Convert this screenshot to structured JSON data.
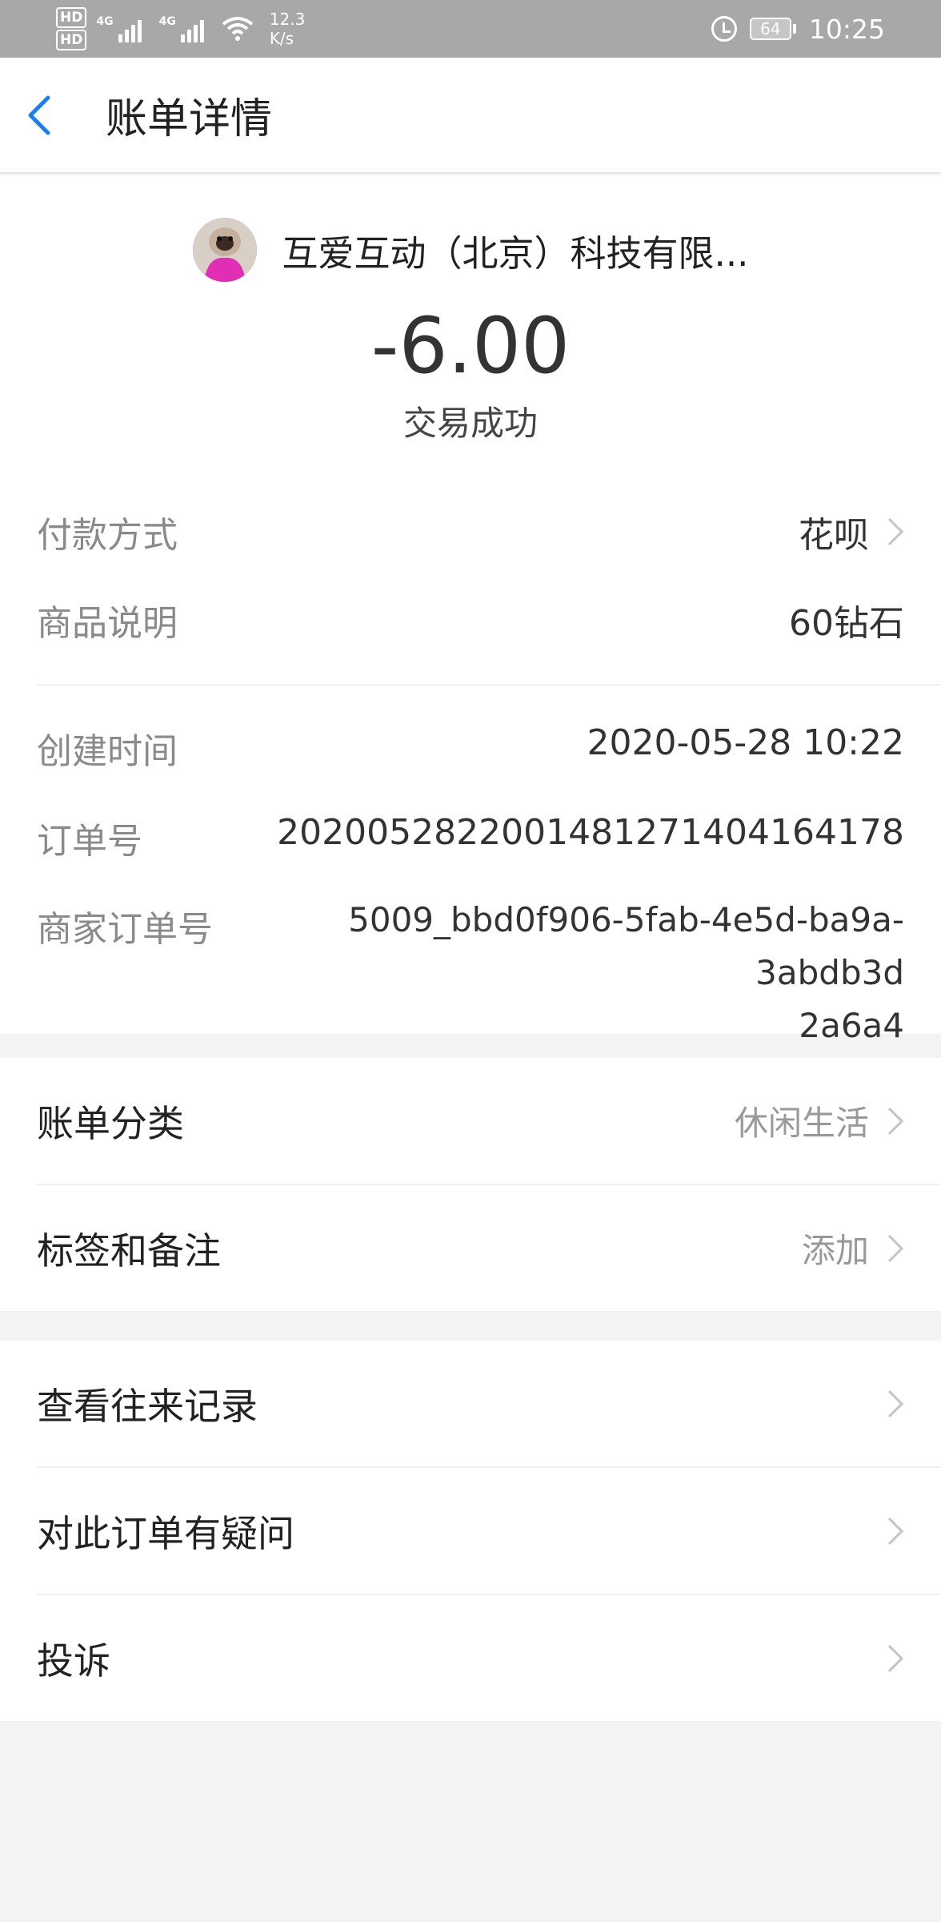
{
  "status_bar": {
    "hd1": "HD",
    "hd2": "HD",
    "net1": "4G",
    "net2": "4G",
    "speed_value": "12.3",
    "speed_unit": "K/s",
    "battery": "64",
    "time": "10:25"
  },
  "header": {
    "title": "账单详情"
  },
  "transaction": {
    "merchant_name": "互爱互动（北京）科技有限...",
    "amount": "-6.00",
    "status": "交易成功"
  },
  "details": {
    "payment_method_label": "付款方式",
    "payment_method_value": "花呗",
    "product_label": "商品说明",
    "product_value": "60钻石",
    "created_label": "创建时间",
    "created_value": "2020-05-28 10:22",
    "order_no_label": "订单号",
    "order_no_value": "2020052822001481271404164178",
    "merchant_order_label": "商家订单号",
    "merchant_order_line1": "5009_bbd0f906-5fab-4e5d-ba9a-3abdb3d",
    "merchant_order_line2": "2a6a4"
  },
  "category": {
    "category_label": "账单分类",
    "category_value": "休闲生活",
    "tags_label": "标签和备注",
    "tags_value": "添加"
  },
  "actions": {
    "history_label": "查看往来记录",
    "question_label": "对此订单有疑问",
    "complaint_label": "投诉"
  },
  "colors": {
    "accent_blue": "#1a7ef0",
    "status_bar": "#a8a8a8",
    "page_bg": "#f3f3f3"
  }
}
